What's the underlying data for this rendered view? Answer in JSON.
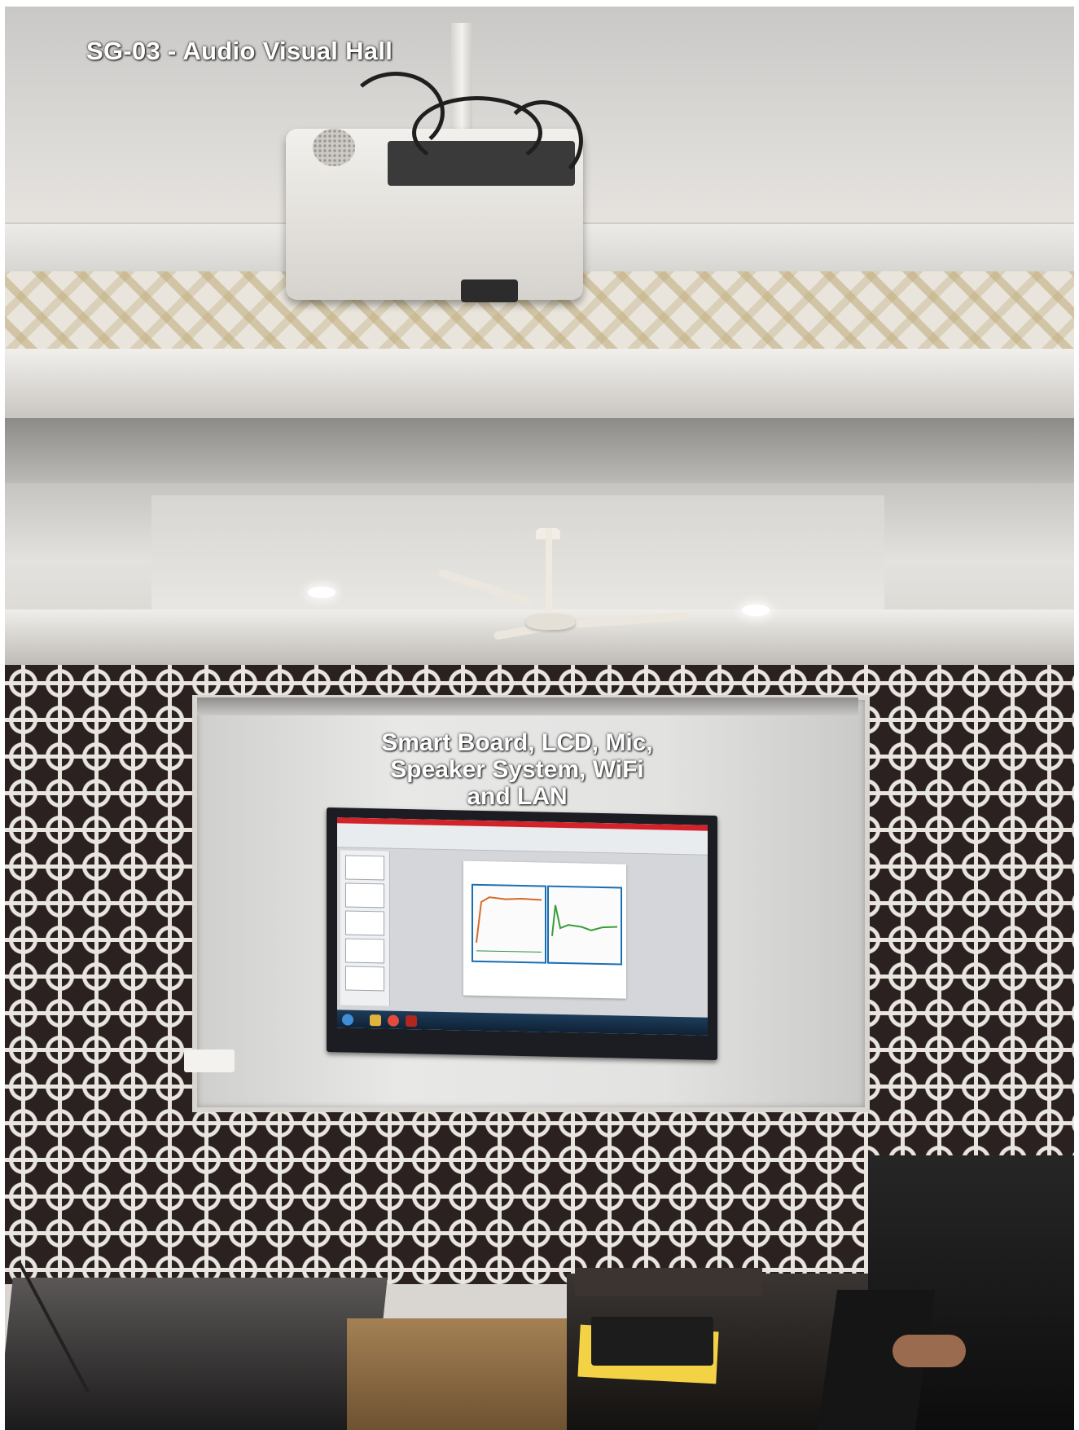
{
  "captions": {
    "room": "SG-03 - Audio Visual Hall",
    "equipment_line1": "Smart Board, LCD, Mic,",
    "equipment_line2": "Speaker System, WiFi",
    "equipment_line3": "and LAN"
  },
  "colors": {
    "caption_text": "#ffffff",
    "ribbon_accent": "#d2232a",
    "plot_border": "#1a6fb3"
  },
  "icons": [
    "windows-start-icon",
    "explorer-icon",
    "chrome-icon",
    "pdf-icon"
  ]
}
